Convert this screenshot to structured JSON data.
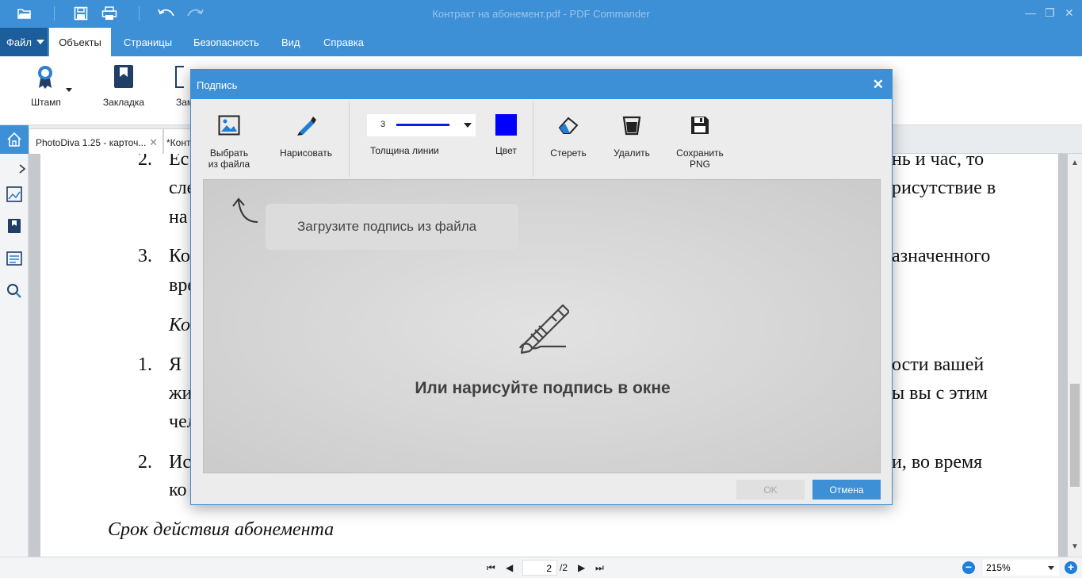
{
  "app": {
    "title": "Контракт на абонемент.pdf - PDF Commander"
  },
  "menu": {
    "file": "Файл",
    "tabs": [
      "Объекты",
      "Страницы",
      "Безопасность",
      "Вид",
      "Справка"
    ]
  },
  "ribbon": {
    "stamp": "Штамп",
    "bookmark": "Закладка",
    "note_partial": "Зам"
  },
  "doctabs": {
    "tab1": "PhotoDiva 1.25 - карточ...",
    "tab2": "*Конт"
  },
  "document": {
    "lines": [
      {
        "num": "2.",
        "text": "Ес",
        "right": "нь и час, то"
      },
      {
        "text": "сле",
        "right": "рисутствие в"
      },
      {
        "text": "на"
      },
      {
        "num": "3.",
        "text": "Ко",
        "right": "азначенного"
      },
      {
        "text": "вре"
      },
      {
        "text": "Ко"
      },
      {
        "num": "1.",
        "text": "Я",
        "right": "ости вашей"
      },
      {
        "text": "жи",
        "right": "ы вы с этим"
      },
      {
        "text": "чел"
      },
      {
        "num": "2.",
        "text": "Ис",
        "right": "и, во время"
      },
      {
        "text": "ко"
      }
    ],
    "heading": "Срок действия абонемента"
  },
  "statusbar": {
    "page_current": "2",
    "page_total": "/2",
    "zoom": "215%"
  },
  "dialog": {
    "title": "Подпись",
    "tools": {
      "from_file": [
        "Выбрать",
        "из файла"
      ],
      "draw": "Нарисовать",
      "thickness_value": "3",
      "thickness_label": "Толщина линии",
      "color_label": "Цвет",
      "erase": "Стереть",
      "delete": "Удалить",
      "save_png": [
        "Сохранить",
        "PNG"
      ]
    },
    "line_color": "#0000ff",
    "upload_hint": "Загрузите подпись из файла",
    "draw_hint": "Или нарисуйте подпись в окне",
    "ok": "OK",
    "cancel": "Отмена"
  },
  "colors": {
    "accent": "#3d8fd6",
    "file_menu": "#1c5d9c"
  }
}
